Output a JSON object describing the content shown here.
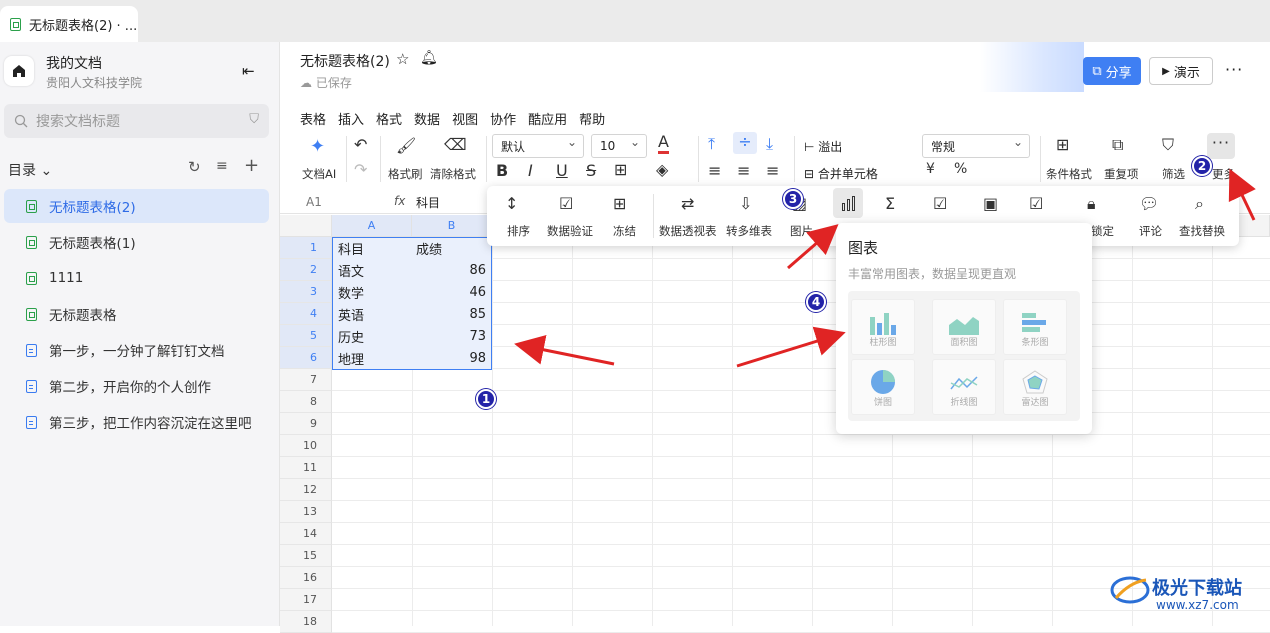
{
  "tab": {
    "title": "无标题表格(2) · ..."
  },
  "sidebar": {
    "title": "我的文档",
    "subtitle": "贵阳人文科技学院",
    "search_placeholder": "搜索文档标题",
    "toc_label": "目录",
    "items": [
      {
        "label": "无标题表格(2)",
        "type": "sheet"
      },
      {
        "label": "无标题表格(1)",
        "type": "sheet"
      },
      {
        "label": "1111",
        "type": "sheet"
      },
      {
        "label": "无标题表格",
        "type": "sheet"
      },
      {
        "label": "第一步，一分钟了解钉钉文档",
        "type": "doc"
      },
      {
        "label": "第二步，开启你的个人创作",
        "type": "doc"
      },
      {
        "label": "第三步，把工作内容沉淀在这里吧",
        "type": "doc"
      }
    ]
  },
  "header": {
    "doc_title": "无标题表格(2)",
    "saved": "已保存",
    "share": "分享",
    "present": "演示",
    "more": "···"
  },
  "menu": [
    "表格",
    "插入",
    "格式",
    "数据",
    "视图",
    "协作",
    "酷应用",
    "帮助"
  ],
  "toolbar": {
    "ai": "文档AI",
    "format_painter": "格式刷",
    "clear_format": "清除格式",
    "font": "默认",
    "size": "10",
    "overflow": "溢出",
    "merge": "合并单元格",
    "number_format": "常规",
    "conditional": "条件格式",
    "duplicate": "重复项",
    "filter": "筛选",
    "more": "更多",
    "pct": "%",
    "currency": "¥"
  },
  "formula_bar": {
    "cell_ref": "A1",
    "fx": "fx",
    "content": "科目"
  },
  "more_popup": {
    "items": [
      "排序",
      "数据验证",
      "冻结",
      "数据透视表",
      "转多维表",
      "图片",
      "锁定",
      "评论",
      "查找替换"
    ]
  },
  "chart_popup": {
    "title": "图表",
    "subtitle": "丰富常用图表，数据呈现更直观",
    "types": [
      "柱形图",
      "面积图",
      "条形图",
      "饼图",
      "折线图",
      "雷达图"
    ]
  },
  "sheet": {
    "columns": [
      "A",
      "B"
    ],
    "rows": [
      {
        "n": "1",
        "a": "科目",
        "b": "成绩"
      },
      {
        "n": "2",
        "a": "语文",
        "b": "86"
      },
      {
        "n": "3",
        "a": "数学",
        "b": "46"
      },
      {
        "n": "4",
        "a": "英语",
        "b": "85"
      },
      {
        "n": "5",
        "a": "历史",
        "b": "73"
      },
      {
        "n": "6",
        "a": "地理",
        "b": "98"
      }
    ],
    "empty_rows": [
      "7",
      "8",
      "9",
      "10",
      "11",
      "12",
      "13",
      "14",
      "15",
      "16",
      "17",
      "18"
    ]
  },
  "badges": [
    "1",
    "2",
    "3",
    "4"
  ],
  "watermark": {
    "name": "极光下载站",
    "url": "www.xz7.com"
  },
  "colors": {
    "accent": "#3f7ff3",
    "selection": "#dce7fa",
    "arrow": "#e02424",
    "badge": "#2323a8"
  }
}
